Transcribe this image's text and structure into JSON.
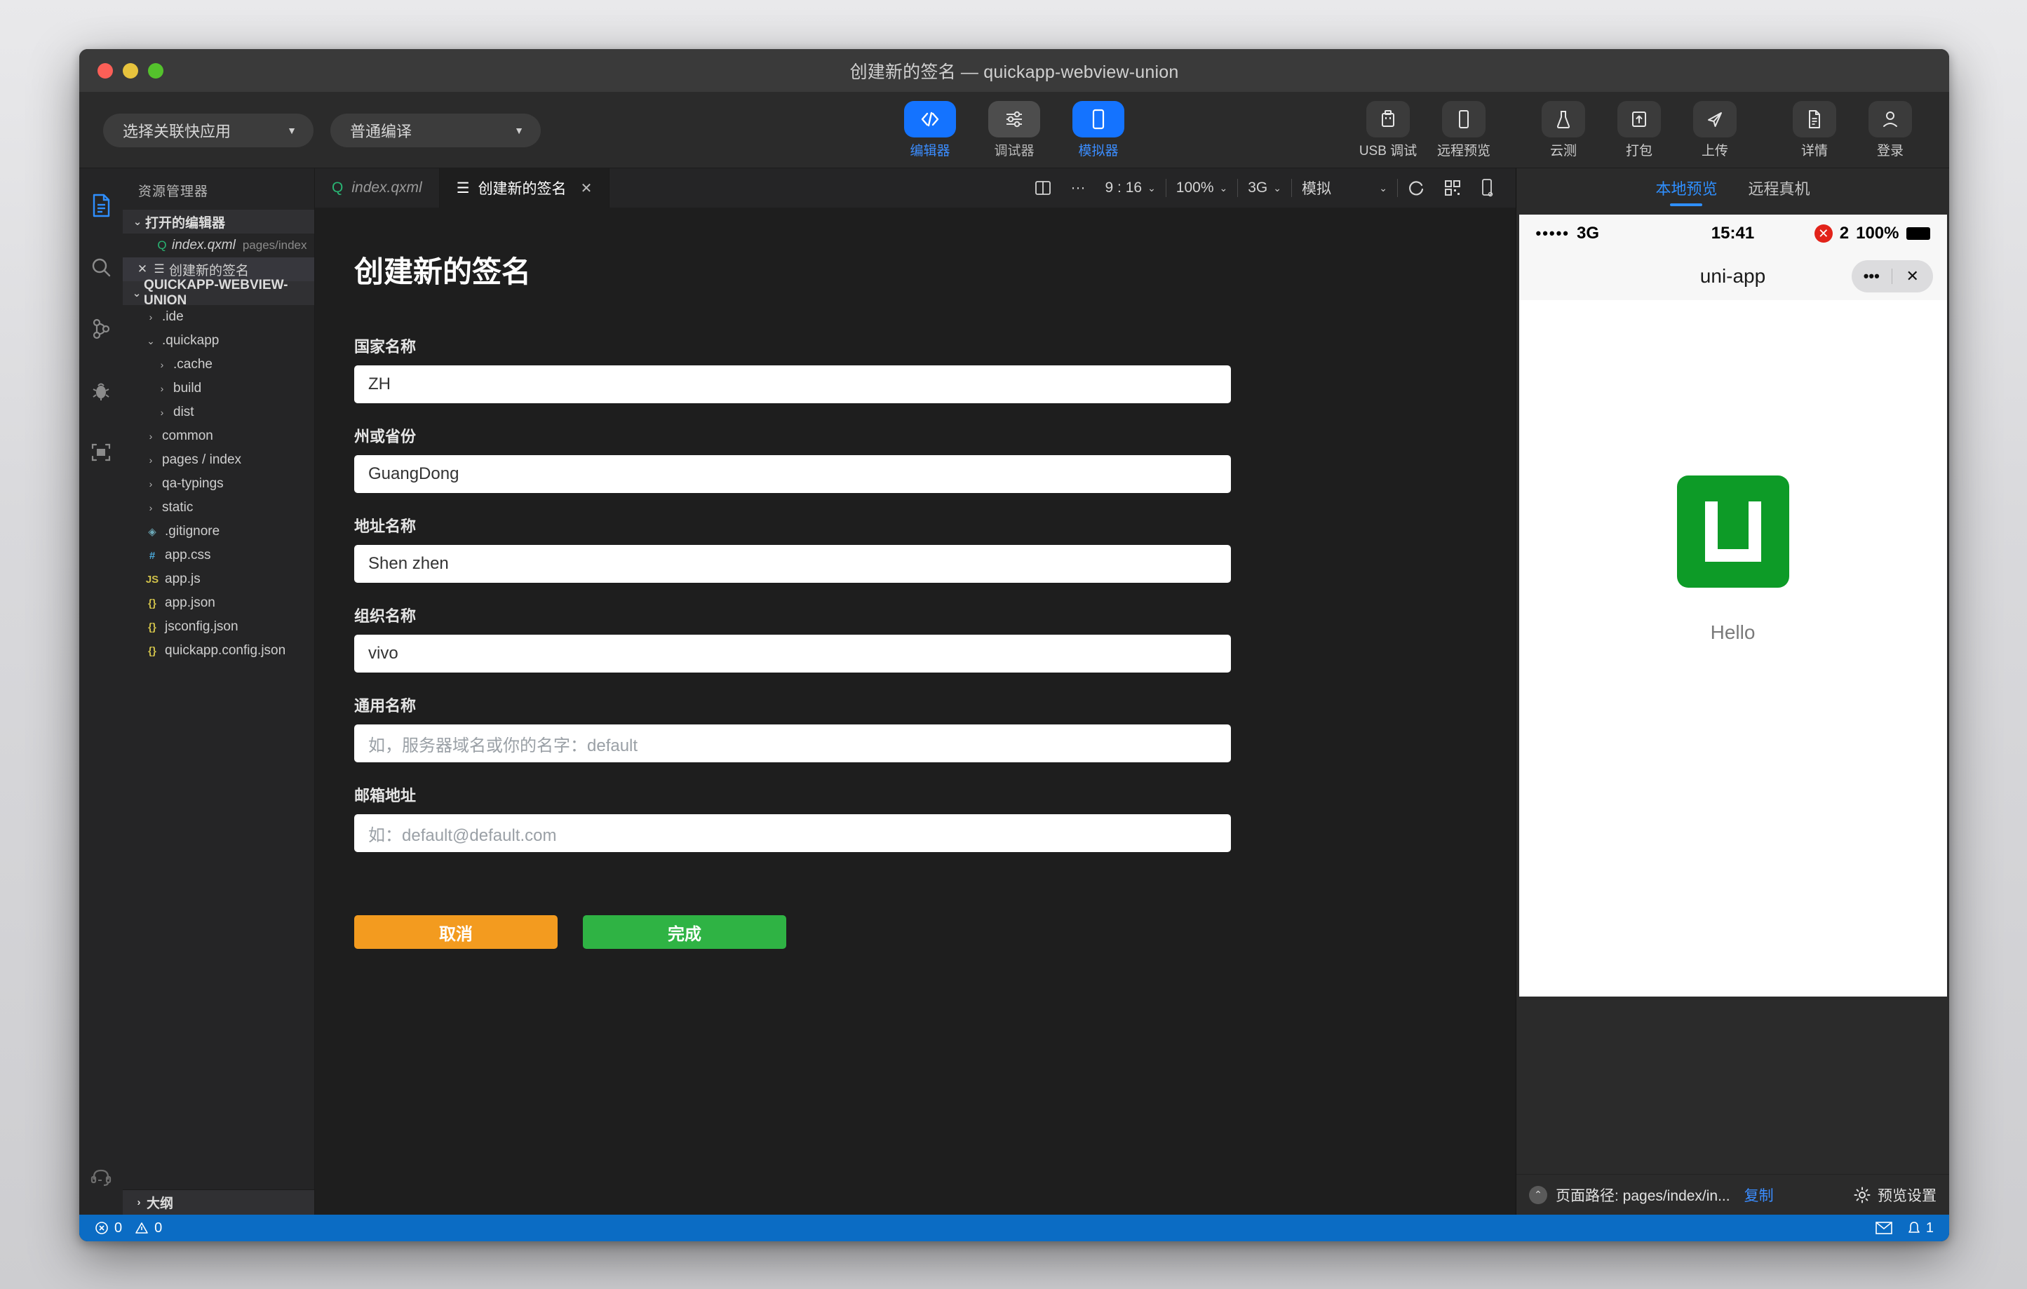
{
  "window": {
    "title": "创建新的签名 — quickapp-webview-union"
  },
  "toolbar": {
    "selects": [
      {
        "label": "选择关联快应用"
      },
      {
        "label": "普通编译"
      }
    ],
    "modes": [
      {
        "label": "编辑器",
        "icon": "code-icon",
        "active": true
      },
      {
        "label": "调试器",
        "icon": "sliders-icon",
        "active": false
      },
      {
        "label": "模拟器",
        "icon": "phone-icon",
        "active": true
      }
    ],
    "right_tools": [
      {
        "label": "USB 调试",
        "icon": "usb-icon"
      },
      {
        "label": "远程预览",
        "icon": "mobile-icon"
      },
      {
        "label": "云测",
        "icon": "flask-icon"
      },
      {
        "label": "打包",
        "icon": "package-icon"
      },
      {
        "label": "上传",
        "icon": "send-icon"
      },
      {
        "label": "详情",
        "icon": "document-icon"
      },
      {
        "label": "登录",
        "icon": "user-icon"
      }
    ]
  },
  "activity_bar": {
    "items": [
      {
        "name": "explorer-icon",
        "active": true
      },
      {
        "name": "search-icon",
        "active": false
      },
      {
        "name": "source-control-icon",
        "active": false
      },
      {
        "name": "debug-icon",
        "active": false
      },
      {
        "name": "extensions-icon",
        "active": false
      }
    ],
    "bottom": {
      "name": "support-headset-icon"
    }
  },
  "explorer": {
    "title": "资源管理器",
    "open_editors_section": "打开的编辑器",
    "open_editors": [
      {
        "name": "index.qxml",
        "sub": "pages/index",
        "icon": "qxml-file-icon",
        "active": false
      },
      {
        "name": "创建新的签名",
        "sub": "",
        "icon": "list-icon",
        "active": true
      }
    ],
    "project_section": "QUICKAPP-WEBVIEW-UNION",
    "tree": [
      {
        "name": ".ide",
        "type": "folder",
        "expanded": false,
        "depth": 1
      },
      {
        "name": ".quickapp",
        "type": "folder",
        "expanded": true,
        "depth": 1
      },
      {
        "name": ".cache",
        "type": "folder",
        "expanded": false,
        "depth": 2
      },
      {
        "name": "build",
        "type": "folder",
        "expanded": false,
        "depth": 2
      },
      {
        "name": "dist",
        "type": "folder",
        "expanded": false,
        "depth": 2
      },
      {
        "name": "common",
        "type": "folder",
        "expanded": false,
        "depth": 1
      },
      {
        "name": "pages / index",
        "type": "folder",
        "expanded": false,
        "depth": 1
      },
      {
        "name": "qa-typings",
        "type": "folder",
        "expanded": false,
        "depth": 1
      },
      {
        "name": "static",
        "type": "folder",
        "expanded": false,
        "depth": 1
      },
      {
        "name": ".gitignore",
        "type": "file",
        "icon": "git-icon",
        "depth": 1
      },
      {
        "name": "app.css",
        "type": "file",
        "icon": "css-icon",
        "depth": 1
      },
      {
        "name": "app.js",
        "type": "file",
        "icon": "js-icon",
        "depth": 1
      },
      {
        "name": "app.json",
        "type": "file",
        "icon": "json-icon",
        "depth": 1
      },
      {
        "name": "jsconfig.json",
        "type": "file",
        "icon": "json-icon",
        "depth": 1
      },
      {
        "name": "quickapp.config.json",
        "type": "file",
        "icon": "json-icon",
        "depth": 1
      }
    ],
    "outline": "大纲"
  },
  "tabs": [
    {
      "label": "index.qxml",
      "icon": "qxml-file-icon",
      "active": false,
      "closable": false
    },
    {
      "label": "创建新的签名",
      "icon": "list-icon",
      "active": true,
      "closable": true
    }
  ],
  "tab_controls": {
    "split_icon": "split-editor-icon",
    "more_icon": "more-icon",
    "ratio": "9 : 16",
    "zoom": "100%",
    "network": "3G",
    "mode": "模拟",
    "refresh_icon": "refresh-icon",
    "qr_icon": "qrcode-icon",
    "device_icon": "device-icon"
  },
  "form": {
    "title": "创建新的签名",
    "fields": [
      {
        "label": "国家名称",
        "value": "ZH",
        "placeholder": "",
        "name": "country-name"
      },
      {
        "label": "州或省份",
        "value": "GuangDong",
        "placeholder": "",
        "name": "state-province"
      },
      {
        "label": "地址名称",
        "value": "Shen zhen",
        "placeholder": "",
        "name": "locality"
      },
      {
        "label": "组织名称",
        "value": "vivo",
        "placeholder": "",
        "name": "organization"
      },
      {
        "label": "通用名称",
        "value": "",
        "placeholder": "如，服务器域名或你的名字：default",
        "name": "common-name"
      },
      {
        "label": "邮箱地址",
        "value": "",
        "placeholder": "如：default@default.com",
        "name": "email-address"
      }
    ],
    "buttons": {
      "cancel": "取消",
      "confirm": "完成"
    }
  },
  "preview": {
    "tabs": [
      {
        "label": "本地预览",
        "active": true
      },
      {
        "label": "远程真机",
        "active": false
      }
    ],
    "phone": {
      "signal_dots": "•••••",
      "network": "3G",
      "time": "15:41",
      "error_count": "2",
      "battery": "100%",
      "nav_title": "uni-app",
      "menu_icon": "more-dots-icon",
      "close_icon": "close-icon",
      "app_label": "Hello",
      "logo_color": "#0d9b27"
    },
    "footer": {
      "path_label": "页面路径: pages/index/in...",
      "copy": "复制",
      "settings": "预览设置",
      "settings_icon": "gear-icon"
    }
  },
  "statusbar": {
    "errors": "0",
    "warnings": "0",
    "error_icon": "error-circle-icon",
    "warning_icon": "warning-triangle-icon",
    "mail_icon": "mail-icon",
    "bell_icon": "bell-icon",
    "notifications": "1"
  },
  "colors": {
    "accent_blue": "#1473ff",
    "status_blue": "#0b6cc4",
    "cancel_orange": "#f39b1f",
    "confirm_green": "#2fb344"
  }
}
